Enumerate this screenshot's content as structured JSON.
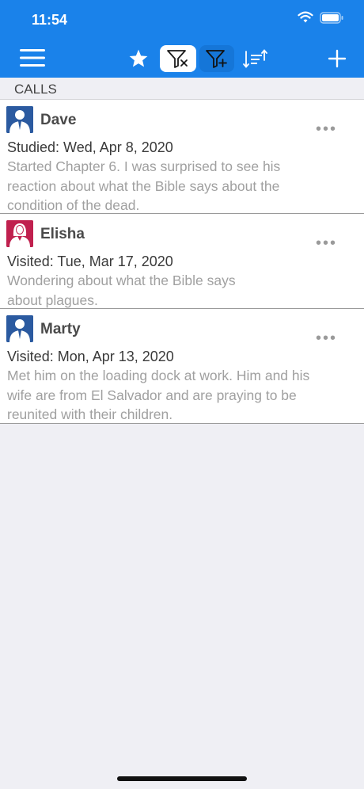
{
  "status": {
    "time": "11:54"
  },
  "toolbar": {
    "menu_icon": "hamburger-menu-icon",
    "favorite_icon": "star-icon",
    "clear_filter_icon": "filter-x-icon",
    "add_filter_icon": "filter-plus-icon",
    "sort_icon": "sort-icon",
    "add_icon": "plus-icon"
  },
  "section": {
    "title": "CALLS"
  },
  "calls": [
    {
      "name": "Dave",
      "gender": "male",
      "visit": "Studied: Wed, Apr 8, 2020",
      "note_lines": [
        "Started Chapter 6. I was surprised to see his",
        "reaction about what the Bible says about the",
        "condition of the dead."
      ],
      "more": "•••"
    },
    {
      "name": "Elisha",
      "gender": "female",
      "visit": "Visited: Tue, Mar 17, 2020",
      "note_lines": [
        "Wondering about what the Bible says",
        "about plagues."
      ],
      "more": "•••"
    },
    {
      "name": "Marty",
      "gender": "male",
      "visit": "Visited: Mon, Apr 13, 2020",
      "note_lines": [
        "Met him on the loading dock at work. Him and his",
        "wife are from El Salvador and are praying to be",
        "reunited with their children."
      ],
      "more": "•••"
    }
  ],
  "colors": {
    "header_blue": "#1a82ea",
    "male_avatar": "#2b5aa0",
    "female_avatar": "#c0204e",
    "background": "#efeff4"
  }
}
